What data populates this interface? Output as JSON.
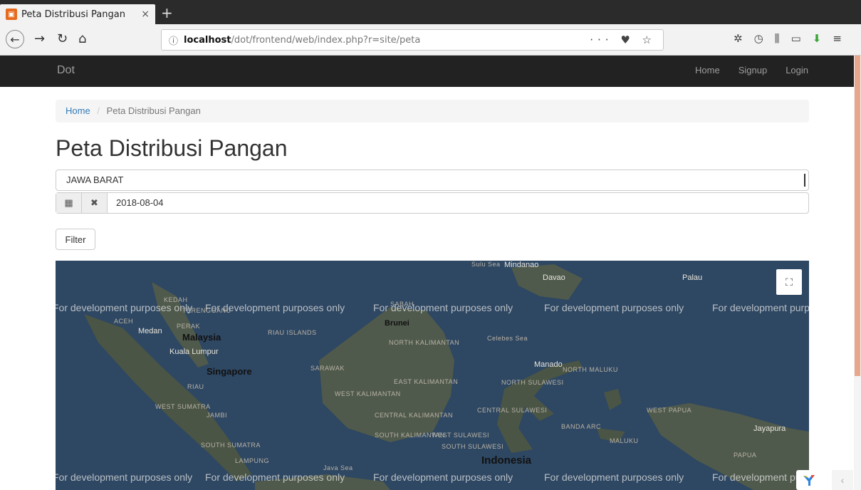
{
  "browser": {
    "tab_title": "Peta Distribusi Pangan",
    "tab_close": "×",
    "new_tab": "+",
    "url_host": "localhost",
    "url_path": "/dot/frontend/web/index.php?r=site/peta",
    "url_actions": "··· ♥ ☆"
  },
  "site": {
    "brand": "Dot",
    "nav": [
      "Home",
      "Signup",
      "Login"
    ]
  },
  "breadcrumb": {
    "home": "Home",
    "sep": "/",
    "current": "Peta Distribusi Pangan"
  },
  "page": {
    "title": "Peta Distribusi Pangan",
    "province": "JAWA BARAT",
    "date": "2018-08-04",
    "filter_label": "Filter"
  },
  "map": {
    "watermark": "For development purposes only",
    "regions": [
      "KEDAH",
      "TERENGGANU",
      "ACEH",
      "PERAK",
      "RIAU ISLANDS",
      "SABAH",
      "NORTH KALIMANTAN",
      "SARAWAK",
      "EAST KALIMANTAN",
      "WEST KALIMANTAN",
      "CENTRAL KALIMANTAN",
      "SOUTH KALIMANTAN",
      "RIAU",
      "WEST SUMATRA",
      "JAMBI",
      "SOUTH SUMATRA",
      "LAMPUNG",
      "NORTH SULAWESI",
      "NORTH MALUKU",
      "CENTRAL SULAWESI",
      "WEST SULAWESI",
      "SOUTH SULAWESI",
      "WEST PAPUA",
      "MALUKU",
      "PAPUA",
      "BANDA ARC"
    ],
    "seas": [
      "Sulu Sea",
      "Celebes Sea",
      "Java Sea"
    ],
    "cities": [
      "Medan",
      "Kuala Lumpur",
      "Brunei",
      "Davao",
      "Mindanao",
      "Manado",
      "Palau",
      "Jayapura"
    ],
    "countries": [
      "Malaysia",
      "Singapore",
      "Indonesia"
    ]
  },
  "colors": {
    "navbar": "#222222",
    "link": "#337ab7",
    "map_water": "#2e4762",
    "map_land": "#4f5a4c"
  }
}
